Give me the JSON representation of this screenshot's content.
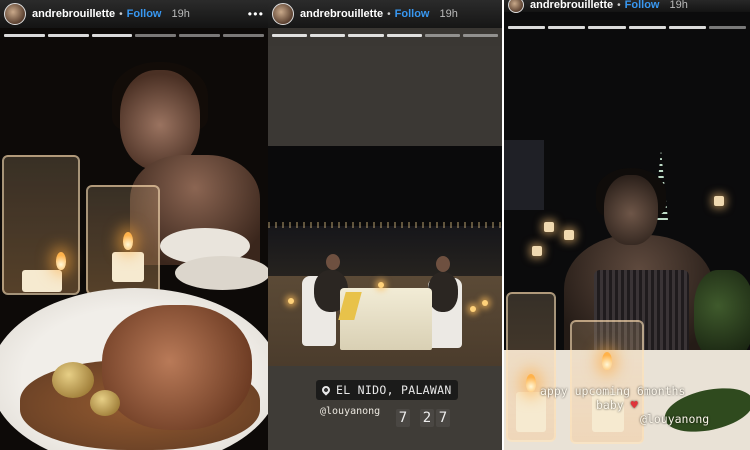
{
  "stories": [
    {
      "username": "andrebrouillette",
      "follow_label": "Follow",
      "time": "19h",
      "more": "• • •"
    },
    {
      "username": "andrebrouillette",
      "follow_label": "Follow",
      "time": "19h",
      "more": "• • •"
    },
    {
      "username": "andrebrouillette",
      "follow_label": "Follow",
      "time": "19h"
    }
  ],
  "location_sticker": "EL NIDO, PALAWAN",
  "mention_2": "@louyanong",
  "time_sticker": {
    "h": "7",
    "m1": "2",
    "m2": "7"
  },
  "caption_3": "appy upcoming 6months",
  "caption_3_line2": "baby",
  "mention_3": "@louyanong",
  "colors": {
    "follow": "#3897f0",
    "heart": "#e0343a"
  }
}
